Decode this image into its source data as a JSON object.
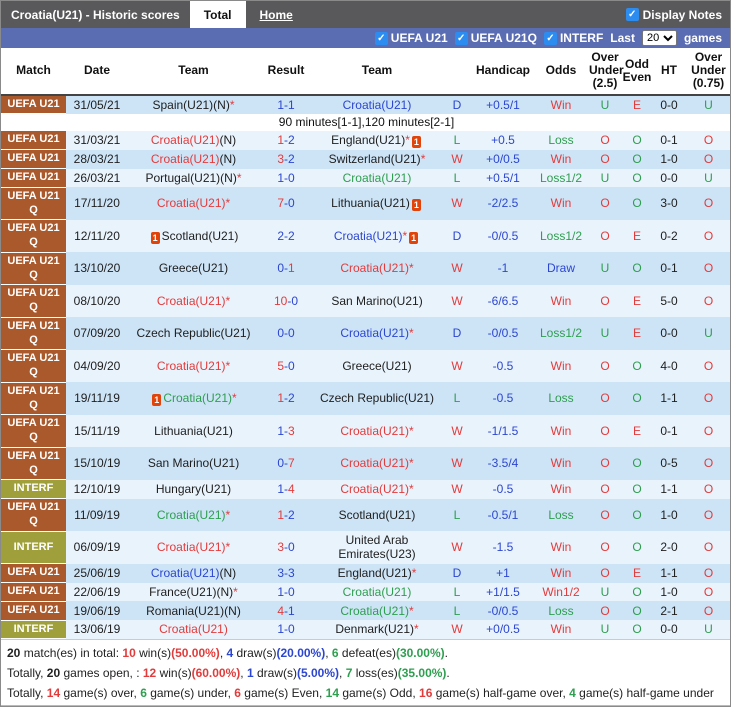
{
  "header": {
    "title": "Croatia(U21) - Historic scores",
    "tabs": [
      {
        "label": "Total",
        "active": true
      },
      {
        "label": "Home",
        "active": false
      }
    ],
    "display_notes_label": "Display Notes"
  },
  "filter_bar": {
    "checkboxes": [
      "UEFA U21",
      "UEFA U21Q",
      "INTERF"
    ],
    "last_label": "Last",
    "last_value": "20",
    "games_label": "games"
  },
  "table": {
    "headers": [
      "Match",
      "Date",
      "Team",
      "Result",
      "Team",
      "",
      "Handicap",
      "Odds",
      "Over Under (2.5)",
      "Odd Even",
      "HT",
      "Over Under (0.75)"
    ]
  },
  "rows": [
    {
      "league": "UEFA U21",
      "date": "31/05/21",
      "home": {
        "name": "Spain(U21)",
        "suffix": "(N)",
        "star": true,
        "color": "black"
      },
      "score": {
        "home": "1",
        "away": "1",
        "home_color": "blue",
        "away_color": "blue"
      },
      "away": {
        "name": "Croatia(U21)",
        "color": "blue"
      },
      "result": "D",
      "handicap": "+0.5/1",
      "odds": "Win",
      "ou25": "U",
      "odd_even": "E",
      "ht": "0-0",
      "ou075": "U",
      "note": "90 minutes[1-1],120 minutes[2-1]"
    },
    {
      "league": "UEFA U21",
      "date": "31/03/21",
      "home": {
        "name": "Croatia(U21)",
        "suffix": "(N)",
        "color": "red"
      },
      "score": {
        "home": "1",
        "away": "2",
        "home_color": "red",
        "away_color": "blue"
      },
      "away": {
        "name": "England(U21)",
        "star": true,
        "color": "black",
        "card": true
      },
      "result": "L",
      "handicap": "+0.5",
      "odds": "Loss",
      "ou25": "O",
      "odd_even": "O",
      "ht": "0-1",
      "ou075": "O"
    },
    {
      "league": "UEFA U21",
      "date": "28/03/21",
      "home": {
        "name": "Croatia(U21)",
        "suffix": "(N)",
        "color": "red"
      },
      "score": {
        "home": "3",
        "away": "2",
        "home_color": "red",
        "away_color": "blue"
      },
      "away": {
        "name": "Switzerland(U21)",
        "star": true,
        "color": "black"
      },
      "result": "W",
      "handicap": "+0/0.5",
      "odds": "Win",
      "ou25": "O",
      "odd_even": "O",
      "ht": "1-0",
      "ou075": "O"
    },
    {
      "league": "UEFA U21",
      "date": "26/03/21",
      "home": {
        "name": "Portugal(U21)",
        "suffix": "(N)",
        "star": true,
        "color": "black"
      },
      "score": {
        "home": "1",
        "away": "0",
        "home_color": "blue",
        "away_color": "blue"
      },
      "away": {
        "name": "Croatia(U21)",
        "color": "green"
      },
      "result": "L",
      "handicap": "+0.5/1",
      "odds": "Loss1/2",
      "ou25": "U",
      "odd_even": "O",
      "ht": "0-0",
      "ou075": "U"
    },
    {
      "league": "UEFA U21 Q",
      "date": "17/11/20",
      "home": {
        "name": "Croatia(U21)",
        "star": true,
        "color": "red"
      },
      "score": {
        "home": "7",
        "away": "0",
        "home_color": "red",
        "away_color": "blue"
      },
      "away": {
        "name": "Lithuania(U21)",
        "color": "black",
        "card": true
      },
      "result": "W",
      "handicap": "-2/2.5",
      "odds": "Win",
      "ou25": "O",
      "odd_even": "O",
      "ht": "3-0",
      "ou075": "O"
    },
    {
      "league": "UEFA U21 Q",
      "date": "12/11/20",
      "home": {
        "name": "Scotland(U21)",
        "color": "black",
        "card": true
      },
      "score": {
        "home": "2",
        "away": "2",
        "home_color": "blue",
        "away_color": "blue"
      },
      "away": {
        "name": "Croatia(U21)",
        "star": true,
        "color": "blue",
        "card": true
      },
      "result": "D",
      "handicap": "-0/0.5",
      "odds": "Loss1/2",
      "ou25": "O",
      "odd_even": "E",
      "ht": "0-2",
      "ou075": "O"
    },
    {
      "league": "UEFA U21 Q",
      "date": "13/10/20",
      "home": {
        "name": "Greece(U21)",
        "color": "black"
      },
      "score": {
        "home": "0",
        "away": "1",
        "home_color": "blue",
        "away_color": "red"
      },
      "away": {
        "name": "Croatia(U21)",
        "star": true,
        "color": "red"
      },
      "result": "W",
      "handicap": "-1",
      "odds": "Draw",
      "ou25": "U",
      "odd_even": "O",
      "ht": "0-1",
      "ou075": "O"
    },
    {
      "league": "UEFA U21 Q",
      "date": "08/10/20",
      "home": {
        "name": "Croatia(U21)",
        "star": true,
        "color": "red"
      },
      "score": {
        "home": "10",
        "away": "0",
        "home_color": "red",
        "away_color": "blue"
      },
      "away": {
        "name": "San Marino(U21)",
        "color": "black"
      },
      "result": "W",
      "handicap": "-6/6.5",
      "odds": "Win",
      "ou25": "O",
      "odd_even": "E",
      "ht": "5-0",
      "ou075": "O"
    },
    {
      "league": "UEFA U21 Q",
      "date": "07/09/20",
      "home": {
        "name": "Czech Republic(U21)",
        "color": "black"
      },
      "score": {
        "home": "0",
        "away": "0",
        "home_color": "blue",
        "away_color": "blue"
      },
      "away": {
        "name": "Croatia(U21)",
        "star": true,
        "color": "blue"
      },
      "result": "D",
      "handicap": "-0/0.5",
      "odds": "Loss1/2",
      "ou25": "U",
      "odd_even": "E",
      "ht": "0-0",
      "ou075": "U"
    },
    {
      "league": "UEFA U21 Q",
      "date": "04/09/20",
      "home": {
        "name": "Croatia(U21)",
        "star": true,
        "color": "red"
      },
      "score": {
        "home": "5",
        "away": "0",
        "home_color": "red",
        "away_color": "blue"
      },
      "away": {
        "name": "Greece(U21)",
        "color": "black"
      },
      "result": "W",
      "handicap": "-0.5",
      "odds": "Win",
      "ou25": "O",
      "odd_even": "O",
      "ht": "4-0",
      "ou075": "O"
    },
    {
      "league": "UEFA U21 Q",
      "date": "19/11/19",
      "home": {
        "name": "Croatia(U21)",
        "star": true,
        "color": "green",
        "card": true
      },
      "score": {
        "home": "1",
        "away": "2",
        "home_color": "red",
        "away_color": "blue"
      },
      "away": {
        "name": "Czech Republic(U21)",
        "color": "black"
      },
      "result": "L",
      "handicap": "-0.5",
      "odds": "Loss",
      "ou25": "O",
      "odd_even": "O",
      "ht": "1-1",
      "ou075": "O"
    },
    {
      "league": "UEFA U21 Q",
      "date": "15/11/19",
      "home": {
        "name": "Lithuania(U21)",
        "color": "black"
      },
      "score": {
        "home": "1",
        "away": "3",
        "home_color": "blue",
        "away_color": "red"
      },
      "away": {
        "name": "Croatia(U21)",
        "star": true,
        "color": "red"
      },
      "result": "W",
      "handicap": "-1/1.5",
      "odds": "Win",
      "ou25": "O",
      "odd_even": "E",
      "ht": "0-1",
      "ou075": "O"
    },
    {
      "league": "UEFA U21 Q",
      "date": "15/10/19",
      "home": {
        "name": "San Marino(U21)",
        "color": "black"
      },
      "score": {
        "home": "0",
        "away": "7",
        "home_color": "blue",
        "away_color": "red"
      },
      "away": {
        "name": "Croatia(U21)",
        "star": true,
        "color": "red"
      },
      "result": "W",
      "handicap": "-3.5/4",
      "odds": "Win",
      "ou25": "O",
      "odd_even": "O",
      "ht": "0-5",
      "ou075": "O"
    },
    {
      "league": "INTERF",
      "date": "12/10/19",
      "home": {
        "name": "Hungary(U21)",
        "color": "black"
      },
      "score": {
        "home": "1",
        "away": "4",
        "home_color": "blue",
        "away_color": "red"
      },
      "away": {
        "name": "Croatia(U21)",
        "star": true,
        "color": "red"
      },
      "result": "W",
      "handicap": "-0.5",
      "odds": "Win",
      "ou25": "O",
      "odd_even": "O",
      "ht": "1-1",
      "ou075": "O"
    },
    {
      "league": "UEFA U21 Q",
      "date": "11/09/19",
      "home": {
        "name": "Croatia(U21)",
        "star": true,
        "color": "green"
      },
      "score": {
        "home": "1",
        "away": "2",
        "home_color": "red",
        "away_color": "blue"
      },
      "away": {
        "name": "Scotland(U21)",
        "color": "black"
      },
      "result": "L",
      "handicap": "-0.5/1",
      "odds": "Loss",
      "ou25": "O",
      "odd_even": "O",
      "ht": "1-0",
      "ou075": "O"
    },
    {
      "league": "INTERF",
      "date": "06/09/19",
      "home": {
        "name": "Croatia(U21)",
        "star": true,
        "color": "red"
      },
      "score": {
        "home": "3",
        "away": "0",
        "home_color": "red",
        "away_color": "blue"
      },
      "away": {
        "name": "United Arab Emirates(U23)",
        "color": "black"
      },
      "result": "W",
      "handicap": "-1.5",
      "odds": "Win",
      "ou25": "O",
      "odd_even": "O",
      "ht": "2-0",
      "ou075": "O"
    },
    {
      "league": "UEFA U21",
      "date": "25/06/19",
      "home": {
        "name": "Croatia(U21)",
        "suffix": "(N)",
        "color": "blue"
      },
      "score": {
        "home": "3",
        "away": "3",
        "home_color": "blue",
        "away_color": "blue"
      },
      "away": {
        "name": "England(U21)",
        "star": true,
        "color": "black"
      },
      "result": "D",
      "handicap": "+1",
      "odds": "Win",
      "ou25": "O",
      "odd_even": "E",
      "ht": "1-1",
      "ou075": "O"
    },
    {
      "league": "UEFA U21",
      "date": "22/06/19",
      "home": {
        "name": "France(U21)",
        "suffix": "(N)",
        "star": true,
        "color": "black"
      },
      "score": {
        "home": "1",
        "away": "0",
        "home_color": "blue",
        "away_color": "blue"
      },
      "away": {
        "name": "Croatia(U21)",
        "color": "green"
      },
      "result": "L",
      "handicap": "+1/1.5",
      "odds": "Win1/2",
      "ou25": "U",
      "odd_even": "O",
      "ht": "1-0",
      "ou075": "O"
    },
    {
      "league": "UEFA U21",
      "date": "19/06/19",
      "home": {
        "name": "Romania(U21)",
        "suffix": "(N)",
        "color": "black"
      },
      "score": {
        "home": "4",
        "away": "1",
        "home_color": "red",
        "away_color": "blue"
      },
      "away": {
        "name": "Croatia(U21)",
        "star": true,
        "color": "green"
      },
      "result": "L",
      "handicap": "-0/0.5",
      "odds": "Loss",
      "ou25": "O",
      "odd_even": "O",
      "ht": "2-1",
      "ou075": "O"
    },
    {
      "league": "INTERF",
      "date": "13/06/19",
      "home": {
        "name": "Croatia(U21)",
        "color": "red"
      },
      "score": {
        "home": "1",
        "away": "0",
        "home_color": "blue",
        "away_color": "blue"
      },
      "away": {
        "name": "Denmark(U21)",
        "star": true,
        "color": "black"
      },
      "result": "W",
      "handicap": "+0/0.5",
      "odds": "Win",
      "ou25": "U",
      "odd_even": "O",
      "ht": "0-0",
      "ou075": "U"
    }
  ],
  "summary": {
    "lines": [
      {
        "segments": [
          {
            "text": "20",
            "bold": true
          },
          {
            "text": " match(es) in total: "
          },
          {
            "text": "10",
            "color": "red",
            "bold": true
          },
          {
            "text": " win(s)"
          },
          {
            "text": "(50.00%)",
            "color": "red",
            "bold": true
          },
          {
            "text": ", "
          },
          {
            "text": "4",
            "color": "blue",
            "bold": true
          },
          {
            "text": " draw(s)"
          },
          {
            "text": "(20.00%)",
            "color": "blue",
            "bold": true
          },
          {
            "text": ", "
          },
          {
            "text": "6",
            "color": "green",
            "bold": true
          },
          {
            "text": " defeat(es)"
          },
          {
            "text": "(30.00%)",
            "color": "green",
            "bold": true
          },
          {
            "text": "."
          }
        ]
      },
      {
        "segments": [
          {
            "text": "Totally, "
          },
          {
            "text": "20",
            "bold": true
          },
          {
            "text": " games open, : "
          },
          {
            "text": "12",
            "color": "red",
            "bold": true
          },
          {
            "text": " win(s)"
          },
          {
            "text": "(60.00%)",
            "color": "red",
            "bold": true
          },
          {
            "text": ", "
          },
          {
            "text": "1",
            "color": "blue",
            "bold": true
          },
          {
            "text": " draw(s)"
          },
          {
            "text": "(5.00%)",
            "color": "blue",
            "bold": true
          },
          {
            "text": ", "
          },
          {
            "text": "7",
            "color": "green",
            "bold": true
          },
          {
            "text": " loss(es)"
          },
          {
            "text": "(35.00%)",
            "color": "green",
            "bold": true
          },
          {
            "text": "."
          }
        ]
      },
      {
        "segments": [
          {
            "text": "Totally, "
          },
          {
            "text": "14",
            "color": "red",
            "bold": true
          },
          {
            "text": " game(s) over, "
          },
          {
            "text": "6",
            "color": "green",
            "bold": true
          },
          {
            "text": " game(s) under, "
          },
          {
            "text": "6",
            "color": "red",
            "bold": true
          },
          {
            "text": " game(s) Even, "
          },
          {
            "text": "14",
            "color": "green",
            "bold": true
          },
          {
            "text": " game(s) Odd, "
          },
          {
            "text": "16",
            "color": "red",
            "bold": true
          },
          {
            "text": " game(s) half-game over, "
          },
          {
            "text": "4",
            "color": "green",
            "bold": true
          },
          {
            "text": " game(s) half-game under"
          }
        ]
      }
    ]
  },
  "colors": {
    "red": "#e23b3b",
    "green": "#2e9e4f",
    "blue": "#2c46cf",
    "black": "#1e1e1e",
    "badge_uefa": "#a9592b",
    "badge_interf": "#9fa03b",
    "bar_dark": "#59595b",
    "bar_blue": "#5a6cb2",
    "row_odd": "#cde4f7",
    "row_even": "#e9f3fc",
    "checkbox_blue": "#2d8cf0"
  }
}
